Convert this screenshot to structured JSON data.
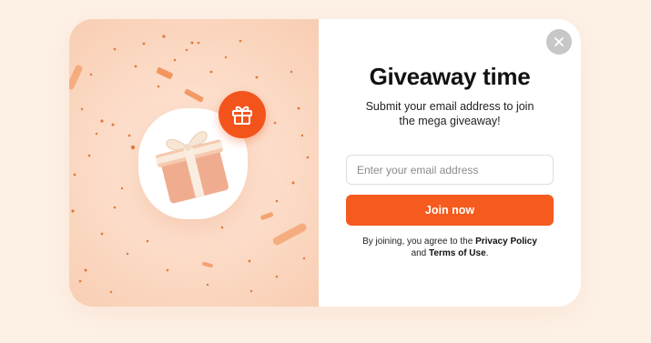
{
  "popup": {
    "title": "Giveaway time",
    "subtitle": "Submit your email address to join the mega giveaway!",
    "email_placeholder": "Enter your email address",
    "email_value": "",
    "join_label": "Join now",
    "terms_prefix": "By joining, you agree to the",
    "privacy_label": "Privacy Policy",
    "terms_and": "and",
    "terms_label": "Terms of Use",
    "terms_suffix": ".",
    "close_icon": "close-icon",
    "badge_icon": "gift-icon",
    "illustration": "gift-box-illustration"
  },
  "colors": {
    "accent": "#f55a1e",
    "page_background": "#fdf0e5",
    "left_panel": "#fcdcc8",
    "close_button": "#c7c7c7"
  }
}
